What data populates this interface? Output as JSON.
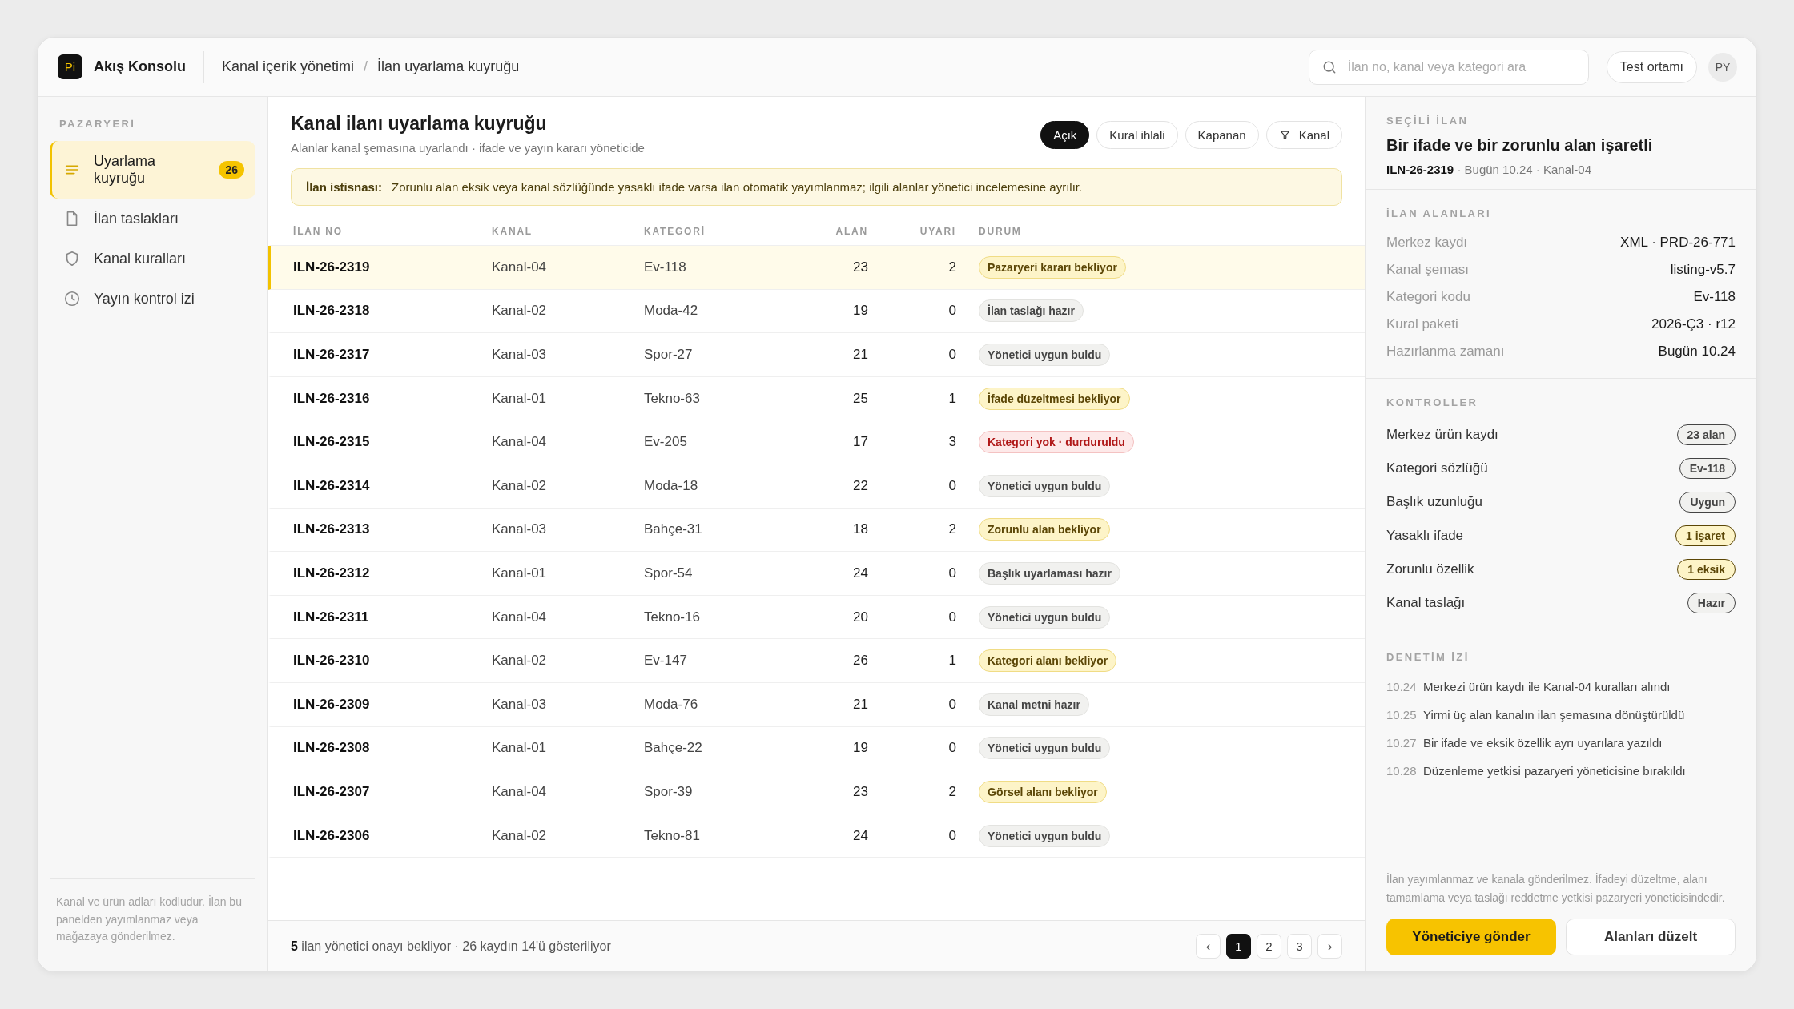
{
  "app": {
    "logo": "Pi",
    "name": "Akış Konsolu"
  },
  "breadcrumb": [
    "Kanal içerik yönetimi",
    "İlan uyarlama kuyruğu"
  ],
  "breadcrumb_separator": "/",
  "search": {
    "placeholder": "İlan no, kanal veya kategori ara"
  },
  "environment_button": "Test ortamı",
  "avatar": "PY",
  "sidebar": {
    "section": "PAZARYERİ",
    "items": [
      {
        "label": "Uyarlama kuyruğu",
        "kind": "list",
        "selected": true,
        "badge": "26"
      },
      {
        "label": "İlan taslakları",
        "kind": "file",
        "selected": false
      },
      {
        "label": "Kanal kuralları",
        "kind": "shield",
        "selected": false
      },
      {
        "label": "Yayın kontrol izi",
        "kind": "clock",
        "selected": false
      }
    ],
    "note": "Kanal ve ürün adları kodludur. İlan bu panelden yayımlanmaz veya mağazaya gönderilmez."
  },
  "main": {
    "title": "Kanal ilanı uyarlama kuyruğu",
    "subtitle": "Alanlar kanal şemasına uyarlandı · ifade ve yayın kararı yöneticide",
    "filters": [
      {
        "label": "Açık",
        "selected": true,
        "kind": "plain"
      },
      {
        "label": "Kural ihlali",
        "selected": false,
        "kind": "plain"
      },
      {
        "label": "Kapanan",
        "selected": false,
        "kind": "plain"
      },
      {
        "label": "Kanal",
        "selected": false,
        "kind": "filter"
      }
    ],
    "notice": {
      "label": "İlan istisnası:",
      "text": "Zorunlu alan eksik veya kanal sözlüğünde yasaklı ifade varsa ilan otomatik yayımlanmaz; ilgili alanlar yönetici incelemesine ayrılır."
    }
  },
  "table": {
    "columns": [
      "İLAN NO",
      "KANAL",
      "KATEGORİ",
      "ALAN",
      "UYARI",
      "DURUM"
    ],
    "rows": [
      {
        "id": "ILN-26-2319",
        "channel": "Kanal-04",
        "category": "Ev-118",
        "fields": "23",
        "warnings": "2",
        "status": "Pazaryeri kararı bekliyor",
        "kind": "warning",
        "selected": true
      },
      {
        "id": "ILN-26-2318",
        "channel": "Kanal-02",
        "category": "Moda-42",
        "fields": "19",
        "warnings": "0",
        "status": "İlan taslağı hazır",
        "kind": "neutral",
        "selected": false
      },
      {
        "id": "ILN-26-2317",
        "channel": "Kanal-03",
        "category": "Spor-27",
        "fields": "21",
        "warnings": "0",
        "status": "Yönetici uygun buldu",
        "kind": "neutral",
        "selected": false
      },
      {
        "id": "ILN-26-2316",
        "channel": "Kanal-01",
        "category": "Tekno-63",
        "fields": "25",
        "warnings": "1",
        "status": "İfade düzeltmesi bekliyor",
        "kind": "warning",
        "selected": false
      },
      {
        "id": "ILN-26-2315",
        "channel": "Kanal-04",
        "category": "Ev-205",
        "fields": "17",
        "warnings": "3",
        "status": "Kategori yok · durduruldu",
        "kind": "danger",
        "selected": false
      },
      {
        "id": "ILN-26-2314",
        "channel": "Kanal-02",
        "category": "Moda-18",
        "fields": "22",
        "warnings": "0",
        "status": "Yönetici uygun buldu",
        "kind": "neutral",
        "selected": false
      },
      {
        "id": "ILN-26-2313",
        "channel": "Kanal-03",
        "category": "Bahçe-31",
        "fields": "18",
        "warnings": "2",
        "status": "Zorunlu alan bekliyor",
        "kind": "warning",
        "selected": false
      },
      {
        "id": "ILN-26-2312",
        "channel": "Kanal-01",
        "category": "Spor-54",
        "fields": "24",
        "warnings": "0",
        "status": "Başlık uyarlaması hazır",
        "kind": "neutral",
        "selected": false
      },
      {
        "id": "ILN-26-2311",
        "channel": "Kanal-04",
        "category": "Tekno-16",
        "fields": "20",
        "warnings": "0",
        "status": "Yönetici uygun buldu",
        "kind": "neutral",
        "selected": false
      },
      {
        "id": "ILN-26-2310",
        "channel": "Kanal-02",
        "category": "Ev-147",
        "fields": "26",
        "warnings": "1",
        "status": "Kategori alanı bekliyor",
        "kind": "warning",
        "selected": false
      },
      {
        "id": "ILN-26-2309",
        "channel": "Kanal-03",
        "category": "Moda-76",
        "fields": "21",
        "warnings": "0",
        "status": "Kanal metni hazır",
        "kind": "neutral",
        "selected": false
      },
      {
        "id": "ILN-26-2308",
        "channel": "Kanal-01",
        "category": "Bahçe-22",
        "fields": "19",
        "warnings": "0",
        "status": "Yönetici uygun buldu",
        "kind": "neutral",
        "selected": false
      },
      {
        "id": "ILN-26-2307",
        "channel": "Kanal-04",
        "category": "Spor-39",
        "fields": "23",
        "warnings": "2",
        "status": "Görsel alanı bekliyor",
        "kind": "warning",
        "selected": false
      },
      {
        "id": "ILN-26-2306",
        "channel": "Kanal-02",
        "category": "Tekno-81",
        "fields": "24",
        "warnings": "0",
        "status": "Yönetici uygun buldu",
        "kind": "neutral",
        "selected": false
      }
    ]
  },
  "footer": {
    "summary": "**5** ilan yönetici onayı bekliyor · 26 kaydın 14'ü gösteriliyor",
    "pagination": [
      {
        "label": "‹",
        "kind": "prev",
        "selected": false
      },
      {
        "label": "1",
        "kind": "page",
        "selected": true
      },
      {
        "label": "2",
        "kind": "page",
        "selected": false
      },
      {
        "label": "3",
        "kind": "page",
        "selected": false
      },
      {
        "label": "›",
        "kind": "next",
        "selected": false
      }
    ]
  },
  "detail": {
    "section": "SEÇİLİ İLAN",
    "title": "Bir ifade ve bir zorunlu alan işaretli",
    "meta": "**ILN-26-2319** · Bugün 10.24 · Kanal-04",
    "fields_section": "İLAN ALANLARI",
    "fields": [
      {
        "label": "Merkez kaydı",
        "value": "XML · PRD-26-771"
      },
      {
        "label": "Kanal şeması",
        "value": "listing-v5.7"
      },
      {
        "label": "Kategori kodu",
        "value": "Ev-118"
      },
      {
        "label": "Kural paketi",
        "value": "2026-Ç3 · r12"
      },
      {
        "label": "Hazırlanma zamanı",
        "value": "Bugün 10.24"
      }
    ],
    "checks_section": "KONTROLLER",
    "checks": [
      {
        "label": "Merkez ürün kaydı",
        "value": "23 alan",
        "kind": "neutral"
      },
      {
        "label": "Kategori sözlüğü",
        "value": "Ev-118",
        "kind": "neutral"
      },
      {
        "label": "Başlık uzunluğu",
        "value": "Uygun",
        "kind": "neutral"
      },
      {
        "label": "Yasaklı ifade",
        "value": "1 işaret",
        "kind": "warning"
      },
      {
        "label": "Zorunlu özellik",
        "value": "1 eksik",
        "kind": "warning"
      },
      {
        "label": "Kanal taslağı",
        "value": "Hazır",
        "kind": "neutral"
      }
    ],
    "audit_section": "DENETİM İZİ",
    "audit": [
      {
        "time": "10.24",
        "text": "Merkezi ürün kaydı ile Kanal-04 kuralları alındı"
      },
      {
        "time": "10.25",
        "text": "Yirmi üç alan kanalın ilan şemasına dönüştürüldü"
      },
      {
        "time": "10.27",
        "text": "Bir ifade ve eksik özellik ayrı uyarılara yazıldı"
      },
      {
        "time": "10.28",
        "text": "Düzenleme yetkisi pazaryeri yöneticisine bırakıldı"
      }
    ],
    "note": "İlan yayımlanmaz ve kanala gönderilmez. İfadeyi düzeltme, alanı tamamlama veya taslağı reddetme yetkisi pazaryeri yöneticisindedir.",
    "primary_button": "Yöneticiye gönder",
    "secondary_button": "Alanları düzelt"
  }
}
